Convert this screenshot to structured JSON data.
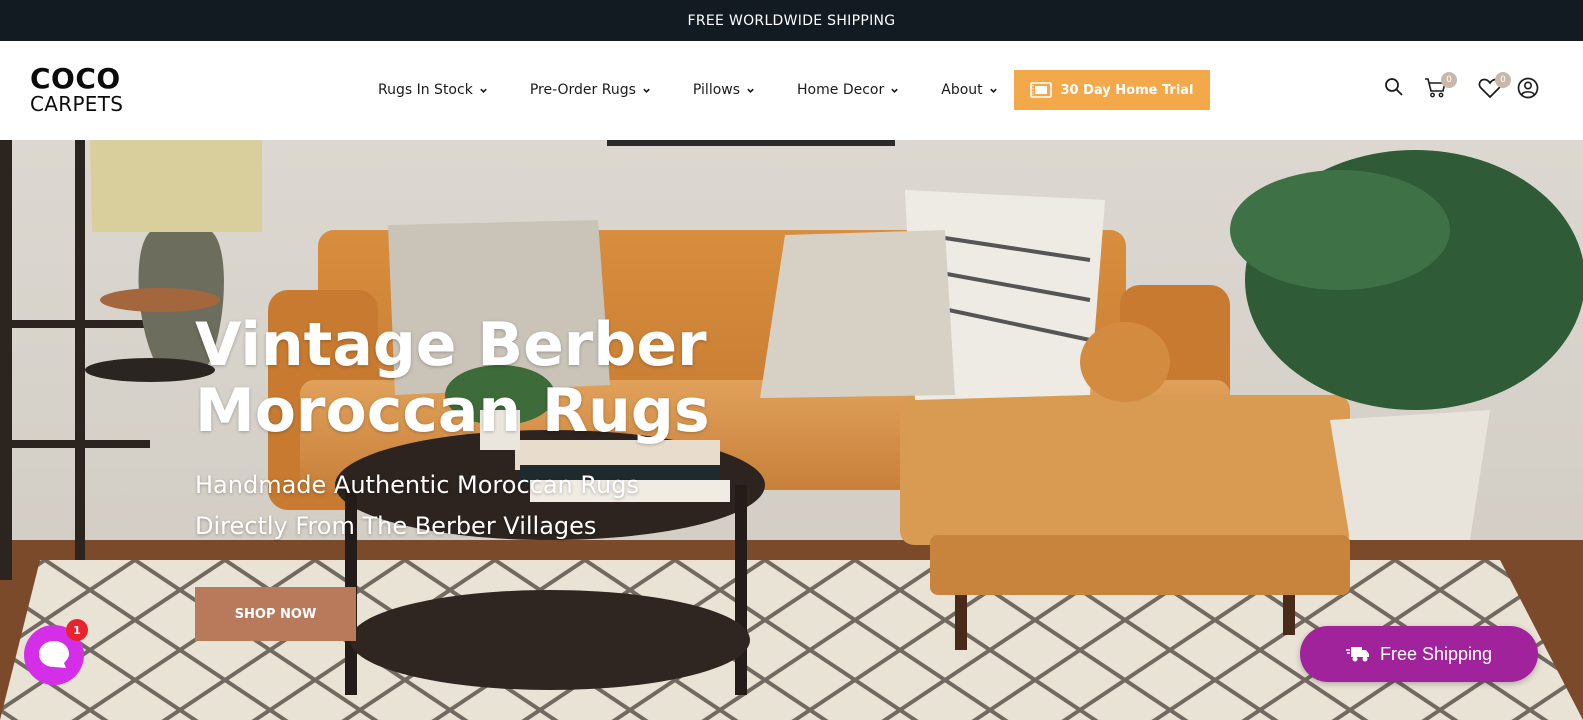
{
  "announcement": {
    "text": "FREE WORLDWIDE SHIPPING"
  },
  "logo": {
    "line1": "COCO",
    "line2": "CARPETS"
  },
  "nav": {
    "items": [
      {
        "label": "Rugs In Stock"
      },
      {
        "label": "Pre-Order Rugs"
      },
      {
        "label": "Pillows"
      },
      {
        "label": "Home Decor"
      },
      {
        "label": "About"
      }
    ],
    "trial_label": "30 Day Home Trial"
  },
  "header_icons": {
    "cart_count": "0",
    "wishlist_count": "0"
  },
  "hero": {
    "title_line1": "Vintage Berber",
    "title_line2": "Moroccan Rugs",
    "subtitle_line1": "Handmade Authentic Moroccan Rugs",
    "subtitle_line2": "Directly From The Berber Villages",
    "cta_label": "SHOP NOW"
  },
  "chat": {
    "unread": "1"
  },
  "shipping_button": {
    "label": "Free Shipping"
  },
  "colors": {
    "announcement_bg": "#121a22",
    "trial_button": "#f3a94a",
    "shop_button": "#b87a5a",
    "shipping_button": "#a0239c",
    "chat_bubble": "#d42ee8"
  }
}
